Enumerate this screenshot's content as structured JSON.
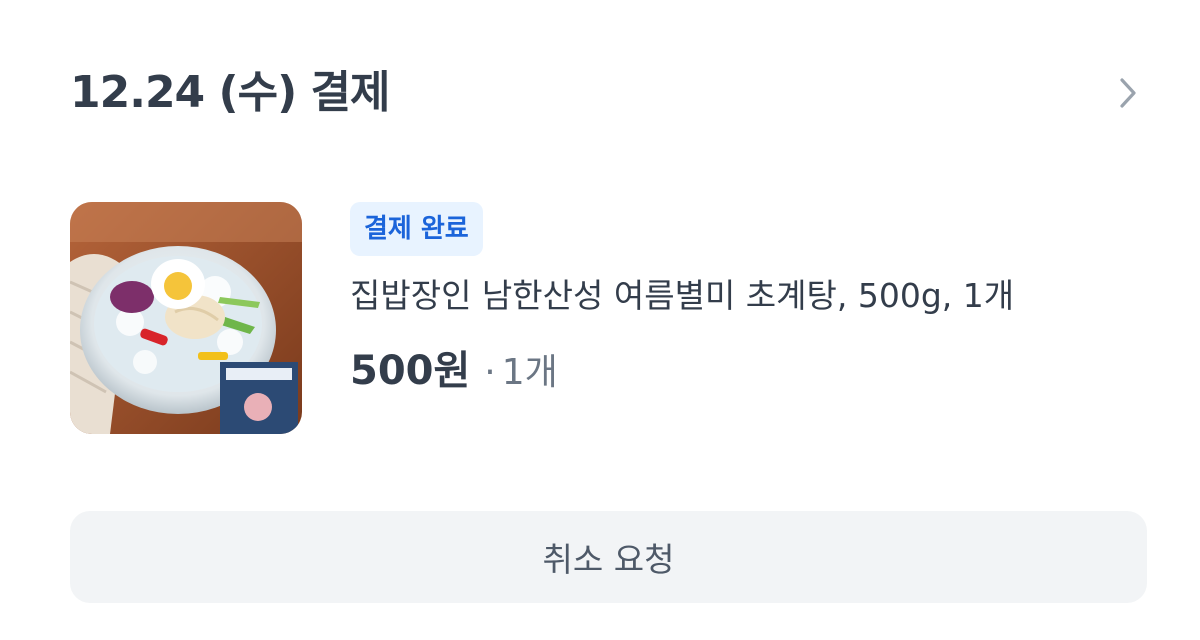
{
  "header": {
    "title": "12.24 (수) 결제",
    "chevron_icon": "chevron-right-icon"
  },
  "order": {
    "status_badge": "결제 완료",
    "product_name": "집밥장인 남한산성 여름별미 초계탕, 500g, 1개",
    "price": "500원",
    "quantity_separator": "·",
    "quantity": "1개",
    "thumbnail": "product-thumbnail"
  },
  "actions": {
    "cancel_label": "취소 요청"
  },
  "colors": {
    "text_primary": "#333d4b",
    "text_secondary": "#6b7684",
    "badge_bg": "#e8f3ff",
    "badge_text": "#1b64da",
    "button_bg": "#f2f4f6",
    "chevron": "#9aa3ad"
  }
}
